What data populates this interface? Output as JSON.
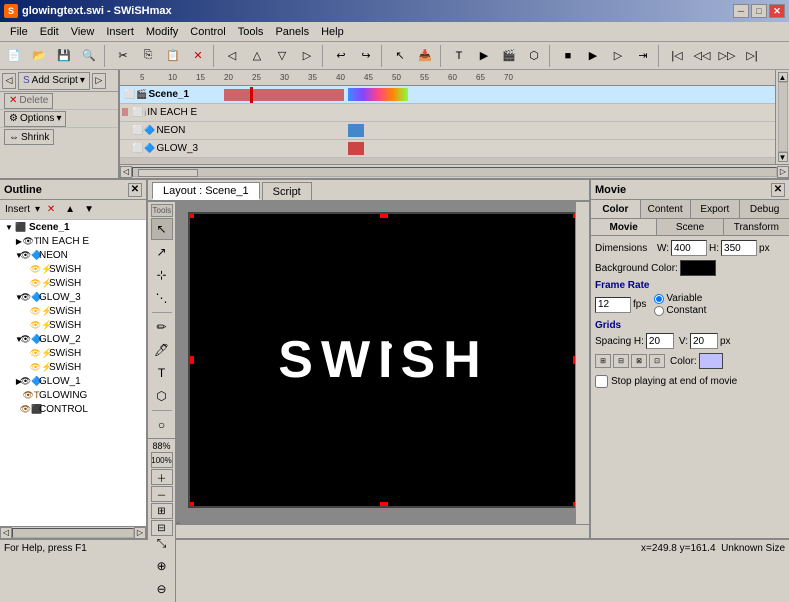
{
  "window": {
    "title": "glowingtext.swi - SWiSHmax",
    "icon": "S"
  },
  "titlebar": {
    "minimize": "─",
    "maximize": "□",
    "close": "✕"
  },
  "menu": {
    "items": [
      "File",
      "Edit",
      "View",
      "Insert",
      "Modify",
      "Control",
      "Tools",
      "Panels",
      "Help"
    ]
  },
  "timeline": {
    "add_script": "Add Script",
    "delete": "Delete",
    "options": "Options",
    "shrink": "Shrink",
    "tracks": [
      {
        "name": "Scene_1",
        "type": "scene",
        "level": 0
      },
      {
        "name": "IN EACH...",
        "type": "effect",
        "level": 1
      },
      {
        "name": "NEON",
        "type": "object",
        "level": 1
      },
      {
        "name": "GLOW_3",
        "type": "object",
        "level": 1
      }
    ],
    "ruler_marks": [
      "5",
      "10",
      "15",
      "20",
      "25",
      "30",
      "35",
      "40",
      "45",
      "50",
      "55",
      "60",
      "65",
      "70"
    ]
  },
  "outline": {
    "title": "Outline",
    "insert_label": "Insert",
    "items": [
      {
        "name": "Scene_1",
        "type": "scene",
        "level": 0,
        "expanded": true
      },
      {
        "name": "IN EACH E",
        "type": "effect",
        "level": 1,
        "expanded": false
      },
      {
        "name": "NEON",
        "type": "group",
        "level": 1,
        "expanded": true
      },
      {
        "name": "SWiSH",
        "type": "effect",
        "level": 2,
        "expanded": false
      },
      {
        "name": "SWiSH",
        "type": "effect2",
        "level": 2,
        "expanded": false
      },
      {
        "name": "GLOW_3",
        "type": "group",
        "level": 1,
        "expanded": true
      },
      {
        "name": "SWiSH",
        "type": "effect",
        "level": 2,
        "expanded": false
      },
      {
        "name": "SWiSH",
        "type": "effect2",
        "level": 2,
        "expanded": false
      },
      {
        "name": "GLOW_2",
        "type": "group",
        "level": 1,
        "expanded": true
      },
      {
        "name": "SWiSH",
        "type": "effect",
        "level": 2,
        "expanded": false
      },
      {
        "name": "SWiSH",
        "type": "effect2",
        "level": 2,
        "expanded": false
      },
      {
        "name": "GLOW_1",
        "type": "group",
        "level": 1,
        "expanded": false
      },
      {
        "name": "GLOWING",
        "type": "text",
        "level": 1,
        "expanded": false
      },
      {
        "name": "CONTROL",
        "type": "control",
        "level": 1,
        "expanded": false
      }
    ]
  },
  "canvas": {
    "tabs": [
      "Layout : Scene_1",
      "Script"
    ],
    "active_tab": "Layout : Scene_1",
    "zoom": "88%",
    "zoom_100": "100%",
    "stage_text": "SWiSH"
  },
  "movie": {
    "title": "Movie",
    "tabs": [
      "Color",
      "Content",
      "Export",
      "Debug"
    ],
    "subtabs": [
      "Movie",
      "Scene",
      "Transform"
    ],
    "active_tab": "Color",
    "active_subtab": "Movie",
    "dimensions": {
      "label": "Dimensions",
      "w_label": "W:",
      "w_value": "400",
      "h_label": "H:",
      "h_value": "350",
      "px_label": "px"
    },
    "background": {
      "label": "Background Color:",
      "color": "#000000"
    },
    "frame_rate": {
      "label": "Frame Rate",
      "value": "12",
      "fps_label": "fps",
      "variable_label": "Variable",
      "constant_label": "Constant"
    },
    "grids": {
      "label": "Grids",
      "spacing_h_label": "Spacing H:",
      "spacing_h_value": "20",
      "v_label": "V:",
      "v_value": "20",
      "px_label": "px",
      "color_label": "Color:"
    },
    "stop_label": "Stop playing at end of movie"
  },
  "status": {
    "help": "For Help, press F1",
    "position": "x=249.8 y=161.4",
    "size": "Unknown Size"
  }
}
